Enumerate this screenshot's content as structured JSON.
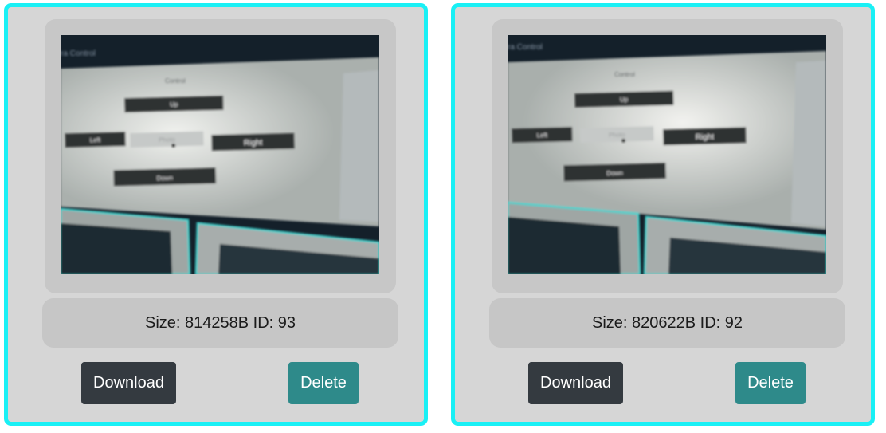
{
  "gallery": {
    "items": [
      {
        "size_text": "Size: 814258B ID: 93",
        "download_label": "Download",
        "delete_label": "Delete",
        "screen": {
          "title": "ra Control",
          "heading": "Control",
          "up": "Up",
          "left": "Left",
          "photo": "Photo",
          "right": "Right",
          "down": "Down"
        }
      },
      {
        "size_text": "Size: 820622B ID: 92",
        "download_label": "Download",
        "delete_label": "Delete",
        "screen": {
          "title": "ra Control",
          "heading": "Control",
          "up": "Up",
          "left": "Left",
          "photo": "Photo",
          "right": "Right",
          "down": "Down"
        }
      }
    ]
  },
  "colors": {
    "card_border": "#19f0f5",
    "card_bg": "#d6d6d6",
    "download_button": "#343a40",
    "delete_button": "#2e8a8a"
  }
}
